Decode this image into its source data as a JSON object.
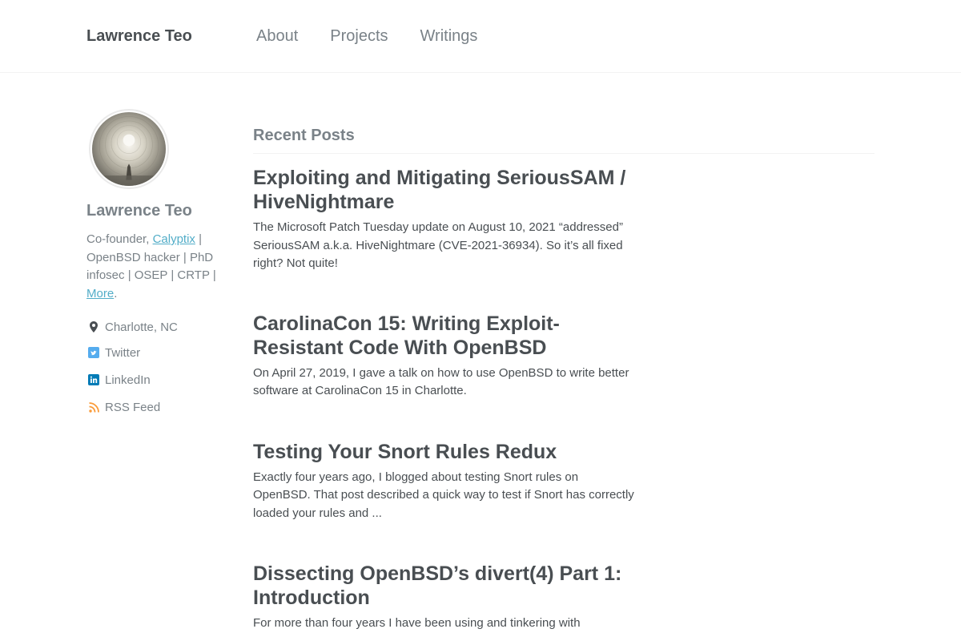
{
  "header": {
    "site_title": "Lawrence Teo",
    "nav": [
      {
        "label": "About"
      },
      {
        "label": "Projects"
      },
      {
        "label": "Writings"
      }
    ]
  },
  "sidebar": {
    "author_name": "Lawrence Teo",
    "bio": {
      "prefix": "Co-founder, ",
      "company_link": "Calyptix",
      "middle": " | OpenBSD hacker | PhD infosec | OSEP | CRTP | ",
      "more_link": "More",
      "suffix": "."
    },
    "links": [
      {
        "label": "Charlotte, NC",
        "icon": "map-marker-icon"
      },
      {
        "label": "Twitter",
        "icon": "twitter-icon"
      },
      {
        "label": "LinkedIn",
        "icon": "linkedin-icon"
      },
      {
        "label": "RSS Feed",
        "icon": "rss-icon"
      }
    ]
  },
  "main": {
    "section_title": "Recent Posts",
    "posts": [
      {
        "title": "Exploiting and Mitigating SeriousSAM / HiveNightmare",
        "excerpt": "The Microsoft Patch Tuesday update on August 10, 2021 “addressed” SeriousSAM a.k.a. HiveNightmare (CVE-2021-36934). So it’s all fixed right? Not quite!"
      },
      {
        "title": "CarolinaCon 15: Writing Exploit-Resistant Code With OpenBSD",
        "excerpt": "On April 27, 2019, I gave a talk on how to use OpenBSD to write better software at CarolinaCon 15 in Charlotte."
      },
      {
        "title": "Testing Your Snort Rules Redux",
        "excerpt": "Exactly four years ago, I blogged about testing Snort rules on OpenBSD. That post described a quick way to test if Snort has correctly loaded your rules and ..."
      },
      {
        "title": "Dissecting OpenBSD’s divert(4) Part 1: Introduction",
        "excerpt": "For more than four years I have been using and tinkering with"
      }
    ]
  },
  "colors": {
    "text": "#494e52",
    "muted": "#7a8288",
    "link": "#52adc8",
    "twitter": "#55acee",
    "linkedin": "#007bb6",
    "rss": "#fa9b39"
  }
}
